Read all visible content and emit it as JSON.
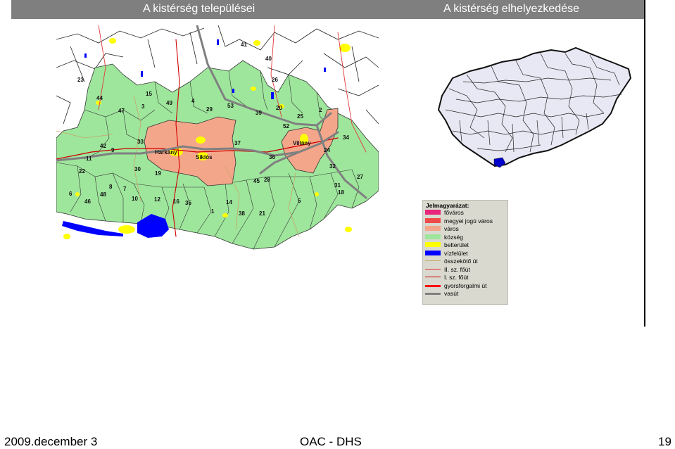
{
  "header": {
    "left_title": "A kistérség települései",
    "right_title": "A kistérség elhelyezkedése"
  },
  "map": {
    "city_labels": [
      "Harkány",
      "Siklós",
      "Villány"
    ],
    "settlement_numbers": [
      "41",
      "40",
      "26",
      "23",
      "44",
      "15",
      "49",
      "4",
      "29",
      "53",
      "39",
      "20",
      "25",
      "2",
      "47",
      "3",
      "52",
      "34",
      "42",
      "33",
      "37",
      "24",
      "36",
      "11",
      "9",
      "30",
      "19",
      "32",
      "27",
      "22",
      "45",
      "28",
      "31",
      "18",
      "7",
      "8",
      "6",
      "46",
      "48",
      "10",
      "12",
      "16",
      "35",
      "1",
      "14",
      "38",
      "21",
      "5"
    ]
  },
  "legend": {
    "title": "Jelmagyarázat:",
    "items": [
      {
        "label": "főváros",
        "color": "#e8247c",
        "kind": "fill"
      },
      {
        "label": "megyei jogú város",
        "color": "#f04a4a",
        "kind": "fill"
      },
      {
        "label": "város",
        "color": "#f4a68a",
        "kind": "fill"
      },
      {
        "label": "község",
        "color": "#9ee69c",
        "kind": "fill"
      },
      {
        "label": "belterület",
        "color": "#ffff00",
        "kind": "fill"
      },
      {
        "label": "vízfelület",
        "color": "#0000ff",
        "kind": "fill"
      },
      {
        "label": "összekötő út",
        "color": "#c8a46a",
        "kind": "line"
      },
      {
        "label": "II. sz. főút",
        "color": "#e03a3a",
        "kind": "line"
      },
      {
        "label": "I. sz. főút",
        "color": "#cc0000",
        "kind": "line"
      },
      {
        "label": "gyorsforgalmi út",
        "color": "#ff0000",
        "kind": "line"
      },
      {
        "label": "vasút",
        "color": "#808080",
        "kind": "line"
      }
    ]
  },
  "footer": {
    "date": "2009.december 3",
    "center": "OAC - DHS",
    "page": "19"
  }
}
